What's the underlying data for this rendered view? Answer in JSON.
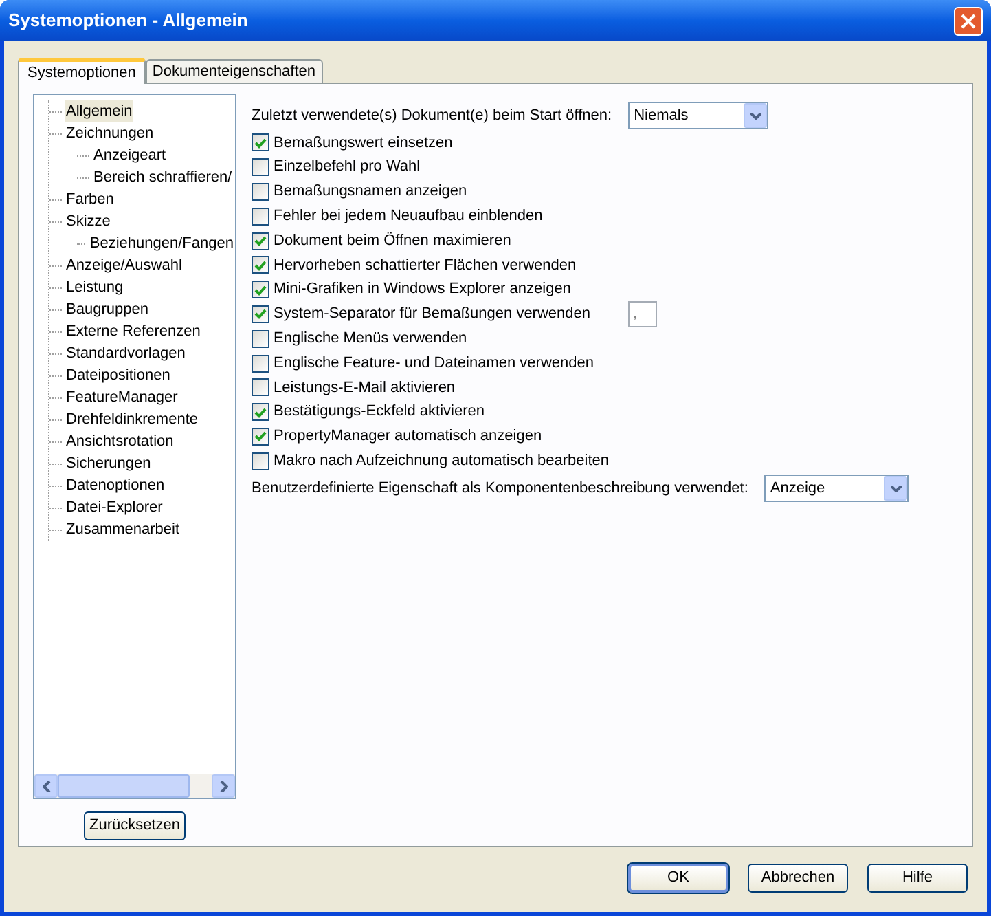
{
  "window": {
    "title": "Systemoptionen - Allgemein"
  },
  "tabs": [
    {
      "label": "Systemoptionen",
      "selected": true
    },
    {
      "label": "Dokumenteigenschaften",
      "selected": false
    }
  ],
  "tree": {
    "items": [
      {
        "label": "Allgemein",
        "selected": true
      },
      {
        "label": "Zeichnungen",
        "selected": false,
        "children": [
          {
            "label": "Anzeigeart",
            "selected": false
          },
          {
            "label": "Bereich schraffieren/",
            "selected": false
          }
        ]
      },
      {
        "label": "Farben",
        "selected": false
      },
      {
        "label": "Skizze",
        "selected": false,
        "children": [
          {
            "label": "Beziehungen/Fangen",
            "selected": false
          }
        ]
      },
      {
        "label": "Anzeige/Auswahl",
        "selected": false
      },
      {
        "label": "Leistung",
        "selected": false
      },
      {
        "label": "Baugruppen",
        "selected": false
      },
      {
        "label": "Externe Referenzen",
        "selected": false
      },
      {
        "label": "Standardvorlagen",
        "selected": false
      },
      {
        "label": "Dateipositionen",
        "selected": false
      },
      {
        "label": "FeatureManager",
        "selected": false
      },
      {
        "label": "Drehfeldinkremente",
        "selected": false
      },
      {
        "label": "Ansichtsrotation",
        "selected": false
      },
      {
        "label": "Sicherungen",
        "selected": false
      },
      {
        "label": "Datenoptionen",
        "selected": false
      },
      {
        "label": "Datei-Explorer",
        "selected": false
      },
      {
        "label": "Zusammenarbeit",
        "selected": false
      }
    ]
  },
  "reset_button": "Zurücksetzen",
  "options": [
    {
      "kind": "dropdown",
      "label": "Zuletzt verwendete(s) Dokument(e) beim Start öffnen:",
      "value": "Niemals"
    },
    {
      "kind": "checkbox",
      "label": "Bemaßungswert einsetzen",
      "checked": true
    },
    {
      "kind": "checkbox",
      "label": "Einzelbefehl pro Wahl",
      "checked": false
    },
    {
      "kind": "checkbox",
      "label": "Bemaßungsnamen anzeigen",
      "checked": false
    },
    {
      "kind": "checkbox",
      "label": "Fehler bei jedem Neuaufbau einblenden",
      "checked": false
    },
    {
      "kind": "checkbox",
      "label": "Dokument beim Öffnen maximieren",
      "checked": true
    },
    {
      "kind": "checkbox",
      "label": "Hervorheben schattierter Flächen verwenden",
      "checked": true
    },
    {
      "kind": "checkbox",
      "label": "Mini-Grafiken in Windows Explorer anzeigen",
      "checked": true
    },
    {
      "kind": "checkbox",
      "label": "System-Separator für Bemaßungen verwenden",
      "checked": true,
      "field_value": ","
    },
    {
      "kind": "checkbox",
      "label": "Englische Menüs verwenden",
      "checked": false
    },
    {
      "kind": "checkbox",
      "label": "Englische Feature- und Dateinamen verwenden",
      "checked": false
    },
    {
      "kind": "checkbox",
      "label": "Leistungs-E-Mail aktivieren",
      "checked": false
    },
    {
      "kind": "checkbox",
      "label": "Bestätigungs-Eckfeld aktivieren",
      "checked": true
    },
    {
      "kind": "checkbox",
      "label": "PropertyManager automatisch anzeigen",
      "checked": true
    },
    {
      "kind": "checkbox",
      "label": "Makro nach Aufzeichnung automatisch bearbeiten",
      "checked": false
    },
    {
      "kind": "dropdown",
      "label": "Benutzerdefinierte Eigenschaft als Komponentenbeschreibung verwendet:",
      "value": "Anzeige"
    }
  ],
  "buttons": [
    {
      "label": "OK",
      "default": true
    },
    {
      "label": "Abbrechen",
      "default": false
    },
    {
      "label": "Hilfe",
      "default": false
    }
  ]
}
